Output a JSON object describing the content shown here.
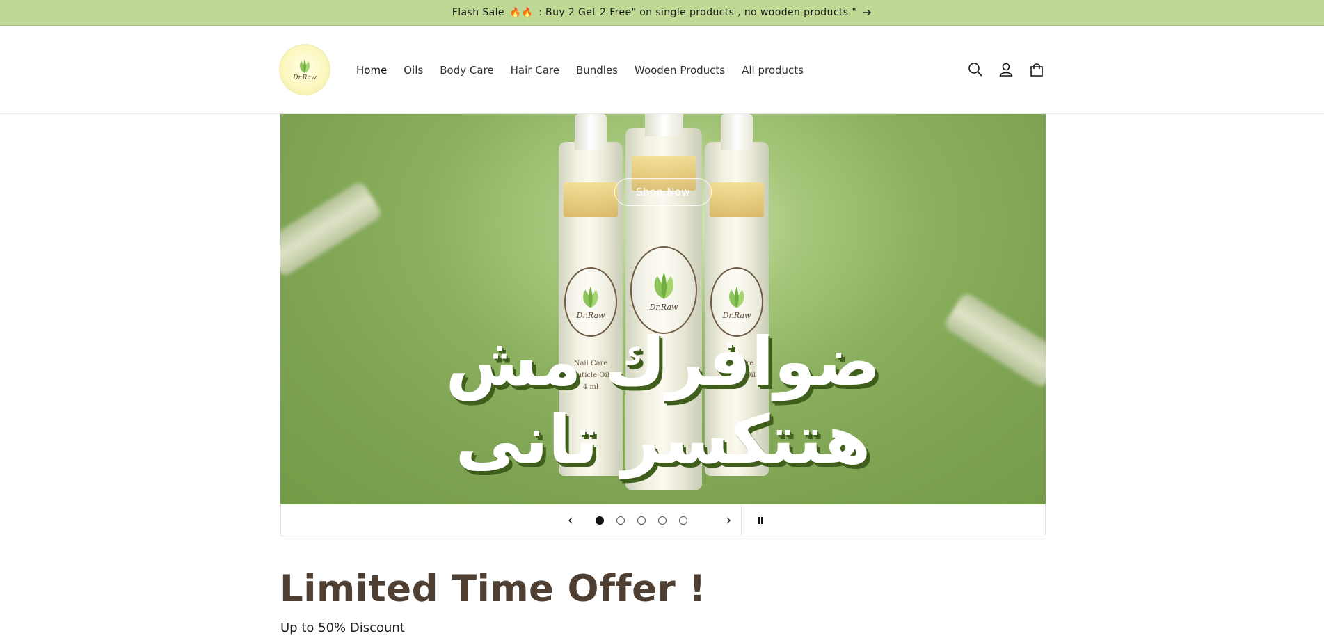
{
  "announcement": {
    "text": "Flash Sale",
    "text_rest": " : Buy 2 Get 2 Free\" on single products , no wooden products \""
  },
  "header": {
    "logo_text": "Dr.Raw",
    "nav": [
      {
        "label": "Home",
        "active": true
      },
      {
        "label": "Oils"
      },
      {
        "label": "Body Care"
      },
      {
        "label": "Hair Care"
      },
      {
        "label": "Bundles"
      },
      {
        "label": "Wooden Products"
      },
      {
        "label": "All products"
      }
    ],
    "icons": [
      "search-icon",
      "account-icon",
      "cart-icon"
    ]
  },
  "hero": {
    "button_label": "Shop Now",
    "arabic_line1": "ضوافرك مش",
    "arabic_line2": "هتتكسر تانى",
    "bottle_brand": "Dr.Raw",
    "bottle_line1": "Nail Care",
    "bottle_line2": "Cuticle Oil",
    "bottle_volume": "4 ml",
    "colors": {
      "background": "#8aaf5e",
      "text_shadow": "#3f5e1c"
    }
  },
  "slider": {
    "slide_count": 5,
    "active_slide": 1
  },
  "offer": {
    "title": "Limited Time Offer !",
    "subtitle": "Up to 50% Discount"
  },
  "colors": {
    "announcement_bg": "#bfd994",
    "title_color": "#4f3f32"
  }
}
